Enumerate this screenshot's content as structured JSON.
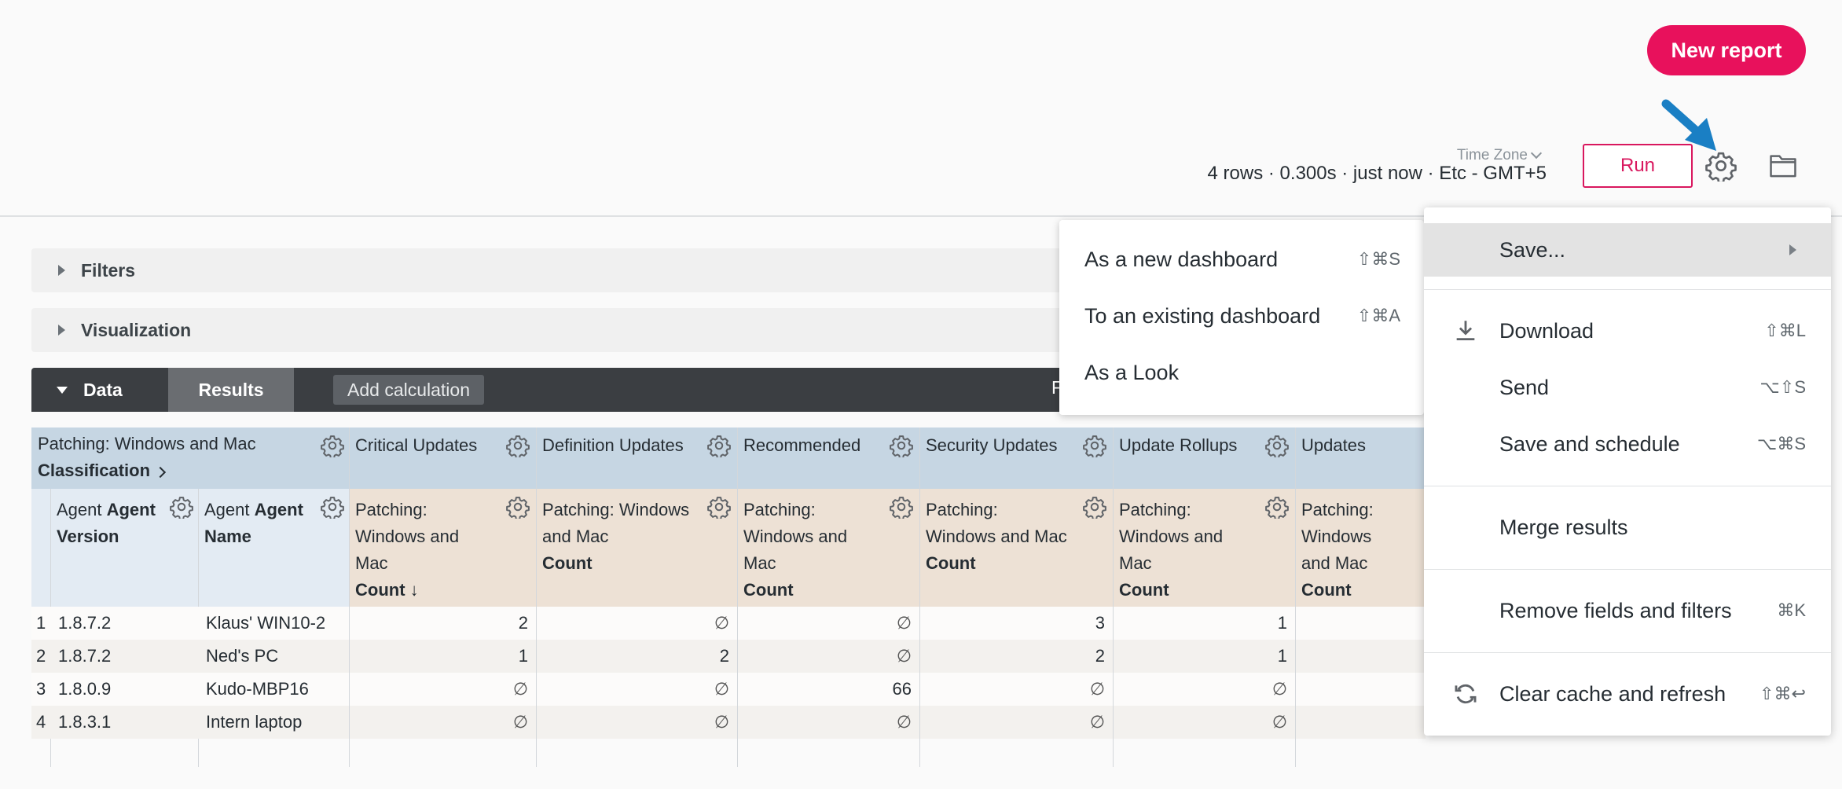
{
  "header": {
    "new_report_label": "New report",
    "timezone_label": "Time Zone",
    "run_info": "4 rows · 0.300s · just now · Etc - GMT+5",
    "run_label": "Run"
  },
  "panels": {
    "filters_label": "Filters",
    "visualization_label": "Visualization"
  },
  "data_bar": {
    "data_label": "Data",
    "results_label": "Results",
    "add_calc_label": "Add calculation",
    "trailing_label": "F"
  },
  "table": {
    "pivot_label": "Patching: Windows and Mac",
    "pivot_field": "Classification",
    "pivot_values": [
      "Critical Updates",
      "Definition Updates",
      "Recommended",
      "Security Updates",
      "Update Rollups",
      "Updates"
    ],
    "dim_headers": [
      {
        "prefix": "Agent ",
        "bold": "Agent Version"
      },
      {
        "prefix": "Agent ",
        "bold": "Agent Name"
      }
    ],
    "measure_headers": [
      {
        "view": "Patching: Windows and Mac",
        "field": "Count ↓"
      },
      {
        "view": "Patching: Windows and Mac",
        "field": "Count"
      },
      {
        "view": "Patching: Windows and Mac",
        "field": "Count"
      },
      {
        "view": "Patching: Windows and Mac",
        "field": "Count"
      },
      {
        "view": "Patching: Windows and Mac",
        "field": "Count"
      },
      {
        "view": "Patching: Windows and Mac",
        "field": "Count"
      }
    ],
    "rows": [
      {
        "n": "1",
        "version": "1.8.7.2",
        "name": "Klaus' WIN10-2",
        "values": [
          "2",
          "∅",
          "∅",
          "3",
          "1",
          ""
        ]
      },
      {
        "n": "2",
        "version": "1.8.7.2",
        "name": "Ned's PC",
        "values": [
          "1",
          "2",
          "∅",
          "2",
          "1",
          ""
        ]
      },
      {
        "n": "3",
        "version": "1.8.0.9",
        "name": "Kudo-MBP16",
        "values": [
          "∅",
          "∅",
          "66",
          "∅",
          "∅",
          ""
        ]
      },
      {
        "n": "4",
        "version": "1.8.3.1",
        "name": "Intern laptop",
        "values": [
          "∅",
          "∅",
          "∅",
          "∅",
          "∅",
          ""
        ]
      }
    ]
  },
  "save_submenu": {
    "items": [
      {
        "label": "As a new dashboard",
        "shortcut": "⇧⌘S"
      },
      {
        "label": "To an existing dashboard",
        "shortcut": "⇧⌘A"
      },
      {
        "label": "As a Look",
        "shortcut": ""
      }
    ]
  },
  "gear_menu": {
    "save": {
      "label": "Save..."
    },
    "download": {
      "label": "Download",
      "shortcut": "⇧⌘L",
      "icon": "download-icon"
    },
    "send": {
      "label": "Send",
      "shortcut": "⌥⇧S"
    },
    "save_schedule": {
      "label": "Save and schedule",
      "shortcut": "⌥⌘S"
    },
    "merge": {
      "label": "Merge results"
    },
    "remove": {
      "label": "Remove fields and filters",
      "shortcut": "⌘K"
    },
    "clear": {
      "label": "Clear cache and refresh",
      "shortcut": "⇧⌘↩",
      "icon": "refresh-icon"
    }
  },
  "colors": {
    "brand_pink": "#e8115c",
    "annotation_arrow": "#1a7fc4",
    "pivot_header": "#c6d6e3",
    "dimension_header": "#e3ebf3",
    "measure_header": "#ede1d5"
  }
}
